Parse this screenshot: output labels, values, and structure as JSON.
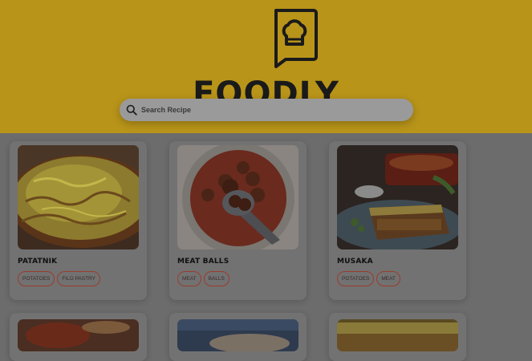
{
  "header": {
    "brand": "FOODLY",
    "logo_icon": "recipe-book-chef-hat-icon",
    "background_color": "#b89419"
  },
  "search": {
    "placeholder": "Search Recipe",
    "value": "",
    "icon": "search-icon"
  },
  "recipes": [
    {
      "title": "PATATNIK",
      "image": "potato-pie-photo",
      "tags": [
        "POTATOES",
        "FILO PASTRY"
      ]
    },
    {
      "title": "MEAT BALLS",
      "image": "meatballs-in-sauce-photo",
      "tags": [
        "MEAT",
        "BALLS"
      ]
    },
    {
      "title": "MUSAKA",
      "image": "musaka-photo",
      "tags": [
        "POTATOES",
        "MEAT"
      ]
    }
  ],
  "more_recipes": [
    {
      "image": "casserole-photo"
    },
    {
      "image": "blue-dish-photo"
    },
    {
      "image": "baked-dish-photo"
    }
  ],
  "colors": {
    "accent": "#b89419",
    "tag_border": "#9b3b2c",
    "overlay_gray": "#6c6c6c"
  }
}
